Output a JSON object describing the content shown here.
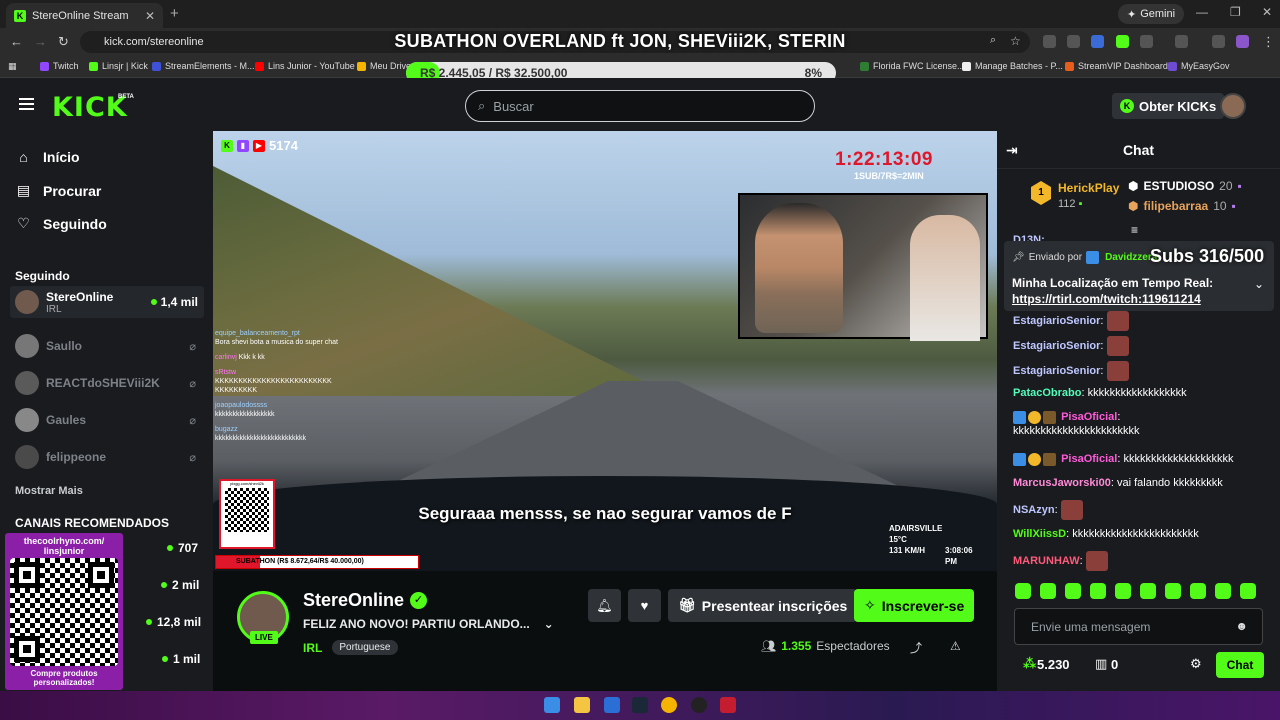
{
  "browser": {
    "tab_title": "StereOnline Stream - Watch",
    "url": "kick.com/stereonline",
    "gemini_label": "Gemini",
    "bookmarks": [
      "Twitch",
      "Linsjr | Kick",
      "StreamElements - M...",
      "Lins Junior - YouTube",
      "Meu Drive",
      "Florida FWC License...",
      "Manage Batches - P...",
      "StreamVIP Dashboard",
      "MyEasyGov"
    ]
  },
  "overlay": {
    "title": "SUBATHON OVERLAND ft JON, SHEViii2K, STERIN",
    "progress_text": "R$ 2.445,05 / R$ 32.500,00",
    "progress_pct_label": "8%",
    "progress_fraction": 0.08,
    "subs_label": "Subs 316/500"
  },
  "header": {
    "logo": "KICK",
    "beta": "BETA",
    "search_placeholder": "Buscar",
    "get_kicks": "Obter KICKs"
  },
  "sidebar": {
    "nav": [
      {
        "label": "Início",
        "icon": "home-icon"
      },
      {
        "label": "Procurar",
        "icon": "browse-icon"
      },
      {
        "label": "Seguindo",
        "icon": "heart-icon"
      }
    ],
    "following_title": "Seguindo",
    "following": [
      {
        "name": "StereOnline",
        "category": "IRL",
        "viewers": "1,4 mil",
        "live": true
      },
      {
        "name": "Saullo",
        "live": false
      },
      {
        "name": "REACTdoSHEViii2K",
        "live": false
      },
      {
        "name": "Gaules",
        "live": false
      },
      {
        "name": "felippeone",
        "live": false
      }
    ],
    "show_more": "Mostrar Mais",
    "recommended_title": "CANAIS RECOMENDADOS",
    "recommended_viewers": [
      "707",
      "2 mil",
      "12,8 mil",
      "1 mil"
    ],
    "promo_top": "thecoolrhyno.com/ linsjunior",
    "promo_bottom": "Compre produtos personalizados!"
  },
  "video": {
    "viewer_count": "5174",
    "timer": "1:22:13:09",
    "timer_sub": "1SUB/7R$=2MIN",
    "caption": "Seguraaa mensss, se nao segurar vamos de F",
    "subathon_bar": "SUBATHON (R$ 8.672,64/R$ 40.000,00)",
    "subathon_fraction": 0.22,
    "location": "ADAIRSVILLE",
    "temp": "15°C",
    "speed": "131 KM/H",
    "time": "3:08:06 PM",
    "qr_label": "pixgg.com/shevii2k",
    "overlay_chat": [
      {
        "user": "equipe_balanceamento_rpt",
        "text": "Bora shevi bota a musica do super chat"
      },
      {
        "user": "carlinvj",
        "text": "Kkk k kk"
      },
      {
        "user": "sRtstw",
        "text": "KKKKKKKKKKKKKKKKKKKKKKKKK KKKKKKKKK"
      },
      {
        "user": "joaopaulodossss",
        "text": "kkkkkkkkkkkkkkkkk"
      },
      {
        "user": "bugazz",
        "text": "kkkkkkkkkkkkkkkkkkkkkkkkkk"
      }
    ]
  },
  "stream": {
    "name": "StereOnline",
    "live_badge": "LIVE",
    "title": "FELIZ ANO NOVO! PARTIU ORLANDO...",
    "category": "IRL",
    "language": "Portuguese",
    "gift_label": "Presentear inscrições",
    "subscribe_label": "Inscrever-se",
    "viewers": "1.355",
    "viewers_label": "Espectadores"
  },
  "chat": {
    "title": "Chat",
    "leaderboard": [
      {
        "rank": "1",
        "name": "HerickPlay",
        "count": "112"
      },
      {
        "name": "ESTUDIOSO",
        "count": "20"
      },
      {
        "name": "filipebarraa",
        "count": "10"
      }
    ],
    "pinned_by_label": "Enviado por",
    "pinned_by": "Davidzzera",
    "pinned_text": "Minha Localização em Tempo Real:",
    "pinned_link": "https://rtirl.com/twitch:119611214",
    "partial_user": "D13N:",
    "messages": [
      {
        "user": "EstagiarioSenior",
        "color": "#bfc7ff",
        "text": "",
        "emote": true
      },
      {
        "user": "EstagiarioSenior",
        "color": "#bfc7ff",
        "text": "",
        "emote": true
      },
      {
        "user": "EstagiarioSenior",
        "color": "#bfc7ff",
        "text": "",
        "emote": true
      },
      {
        "user": "PatacObrabo",
        "color": "#53fcb8",
        "text": "kkkkkkkkkkkkkkkkkk"
      },
      {
        "user": "PisaOficial",
        "color": "#ff5ad9",
        "text": "kkkkkkkkkkkkkkkkkkkkkkk",
        "badges": true
      },
      {
        "user": "PisaOficial",
        "color": "#ff5ad9",
        "text": "kkkkkkkkkkkkkkkkkkkk",
        "badges": true
      },
      {
        "user": "MarcusJaworski00",
        "color": "#ff8ad8",
        "text": "vai falando kkkkkkkkk"
      },
      {
        "user": "NSAzyn",
        "color": "#bfc7ff",
        "text": "",
        "emote": true
      },
      {
        "user": "WillXiissD",
        "color": "#53fc18",
        "text": "kkkkkkkkkkkkkkkkkkkkkkk"
      },
      {
        "user": "MARUNHAW",
        "color": "#ff5a7a",
        "text": "",
        "emote": true
      }
    ],
    "input_placeholder": "Envie uma mensagem",
    "kicks_balance": "5.230",
    "store_count": "0",
    "send_label": "Chat"
  }
}
